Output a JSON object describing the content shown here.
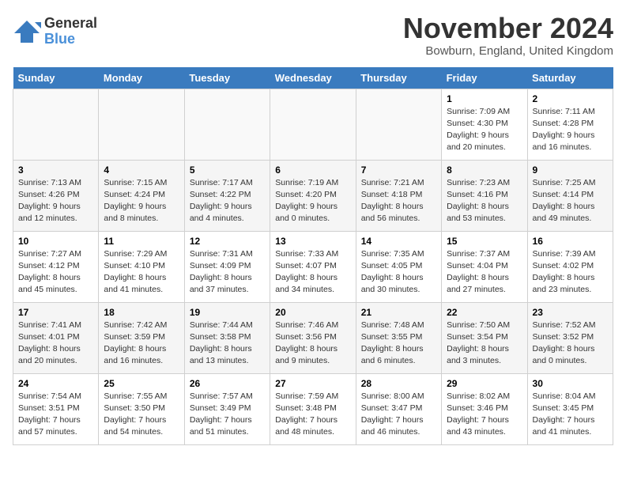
{
  "logo": {
    "general": "General",
    "blue": "Blue"
  },
  "title": "November 2024",
  "location": "Bowburn, England, United Kingdom",
  "days_of_week": [
    "Sunday",
    "Monday",
    "Tuesday",
    "Wednesday",
    "Thursday",
    "Friday",
    "Saturday"
  ],
  "weeks": [
    [
      {
        "day": "",
        "info": ""
      },
      {
        "day": "",
        "info": ""
      },
      {
        "day": "",
        "info": ""
      },
      {
        "day": "",
        "info": ""
      },
      {
        "day": "",
        "info": ""
      },
      {
        "day": "1",
        "info": "Sunrise: 7:09 AM\nSunset: 4:30 PM\nDaylight: 9 hours\nand 20 minutes."
      },
      {
        "day": "2",
        "info": "Sunrise: 7:11 AM\nSunset: 4:28 PM\nDaylight: 9 hours\nand 16 minutes."
      }
    ],
    [
      {
        "day": "3",
        "info": "Sunrise: 7:13 AM\nSunset: 4:26 PM\nDaylight: 9 hours\nand 12 minutes."
      },
      {
        "day": "4",
        "info": "Sunrise: 7:15 AM\nSunset: 4:24 PM\nDaylight: 9 hours\nand 8 minutes."
      },
      {
        "day": "5",
        "info": "Sunrise: 7:17 AM\nSunset: 4:22 PM\nDaylight: 9 hours\nand 4 minutes."
      },
      {
        "day": "6",
        "info": "Sunrise: 7:19 AM\nSunset: 4:20 PM\nDaylight: 9 hours\nand 0 minutes."
      },
      {
        "day": "7",
        "info": "Sunrise: 7:21 AM\nSunset: 4:18 PM\nDaylight: 8 hours\nand 56 minutes."
      },
      {
        "day": "8",
        "info": "Sunrise: 7:23 AM\nSunset: 4:16 PM\nDaylight: 8 hours\nand 53 minutes."
      },
      {
        "day": "9",
        "info": "Sunrise: 7:25 AM\nSunset: 4:14 PM\nDaylight: 8 hours\nand 49 minutes."
      }
    ],
    [
      {
        "day": "10",
        "info": "Sunrise: 7:27 AM\nSunset: 4:12 PM\nDaylight: 8 hours\nand 45 minutes."
      },
      {
        "day": "11",
        "info": "Sunrise: 7:29 AM\nSunset: 4:10 PM\nDaylight: 8 hours\nand 41 minutes."
      },
      {
        "day": "12",
        "info": "Sunrise: 7:31 AM\nSunset: 4:09 PM\nDaylight: 8 hours\nand 37 minutes."
      },
      {
        "day": "13",
        "info": "Sunrise: 7:33 AM\nSunset: 4:07 PM\nDaylight: 8 hours\nand 34 minutes."
      },
      {
        "day": "14",
        "info": "Sunrise: 7:35 AM\nSunset: 4:05 PM\nDaylight: 8 hours\nand 30 minutes."
      },
      {
        "day": "15",
        "info": "Sunrise: 7:37 AM\nSunset: 4:04 PM\nDaylight: 8 hours\nand 27 minutes."
      },
      {
        "day": "16",
        "info": "Sunrise: 7:39 AM\nSunset: 4:02 PM\nDaylight: 8 hours\nand 23 minutes."
      }
    ],
    [
      {
        "day": "17",
        "info": "Sunrise: 7:41 AM\nSunset: 4:01 PM\nDaylight: 8 hours\nand 20 minutes."
      },
      {
        "day": "18",
        "info": "Sunrise: 7:42 AM\nSunset: 3:59 PM\nDaylight: 8 hours\nand 16 minutes."
      },
      {
        "day": "19",
        "info": "Sunrise: 7:44 AM\nSunset: 3:58 PM\nDaylight: 8 hours\nand 13 minutes."
      },
      {
        "day": "20",
        "info": "Sunrise: 7:46 AM\nSunset: 3:56 PM\nDaylight: 8 hours\nand 9 minutes."
      },
      {
        "day": "21",
        "info": "Sunrise: 7:48 AM\nSunset: 3:55 PM\nDaylight: 8 hours\nand 6 minutes."
      },
      {
        "day": "22",
        "info": "Sunrise: 7:50 AM\nSunset: 3:54 PM\nDaylight: 8 hours\nand 3 minutes."
      },
      {
        "day": "23",
        "info": "Sunrise: 7:52 AM\nSunset: 3:52 PM\nDaylight: 8 hours\nand 0 minutes."
      }
    ],
    [
      {
        "day": "24",
        "info": "Sunrise: 7:54 AM\nSunset: 3:51 PM\nDaylight: 7 hours\nand 57 minutes."
      },
      {
        "day": "25",
        "info": "Sunrise: 7:55 AM\nSunset: 3:50 PM\nDaylight: 7 hours\nand 54 minutes."
      },
      {
        "day": "26",
        "info": "Sunrise: 7:57 AM\nSunset: 3:49 PM\nDaylight: 7 hours\nand 51 minutes."
      },
      {
        "day": "27",
        "info": "Sunrise: 7:59 AM\nSunset: 3:48 PM\nDaylight: 7 hours\nand 48 minutes."
      },
      {
        "day": "28",
        "info": "Sunrise: 8:00 AM\nSunset: 3:47 PM\nDaylight: 7 hours\nand 46 minutes."
      },
      {
        "day": "29",
        "info": "Sunrise: 8:02 AM\nSunset: 3:46 PM\nDaylight: 7 hours\nand 43 minutes."
      },
      {
        "day": "30",
        "info": "Sunrise: 8:04 AM\nSunset: 3:45 PM\nDaylight: 7 hours\nand 41 minutes."
      }
    ]
  ]
}
